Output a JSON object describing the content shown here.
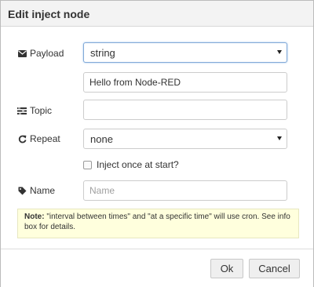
{
  "dialog": {
    "title": "Edit inject node"
  },
  "payload": {
    "label": "Payload",
    "icon": "envelope-icon",
    "type_value": "string",
    "value": "Hello from Node-RED"
  },
  "topic": {
    "label": "Topic",
    "icon": "tasks-icon",
    "value": ""
  },
  "repeat": {
    "label": "Repeat",
    "icon": "repeat-icon",
    "value": "none"
  },
  "inject_once": {
    "label": "Inject once at start?",
    "checked": false
  },
  "name": {
    "label": "Name",
    "icon": "tag-icon",
    "placeholder": "Name",
    "value": ""
  },
  "note": {
    "bold": "Note:",
    "text": " \"interval between times\" and \"at a specific time\" will use cron. See info box for details."
  },
  "buttons": {
    "ok": "Ok",
    "cancel": "Cancel"
  },
  "colors": {
    "title_bar": "#f3f3f3",
    "note_background": "#ffffdd",
    "focus_border": "#82a9d8"
  }
}
